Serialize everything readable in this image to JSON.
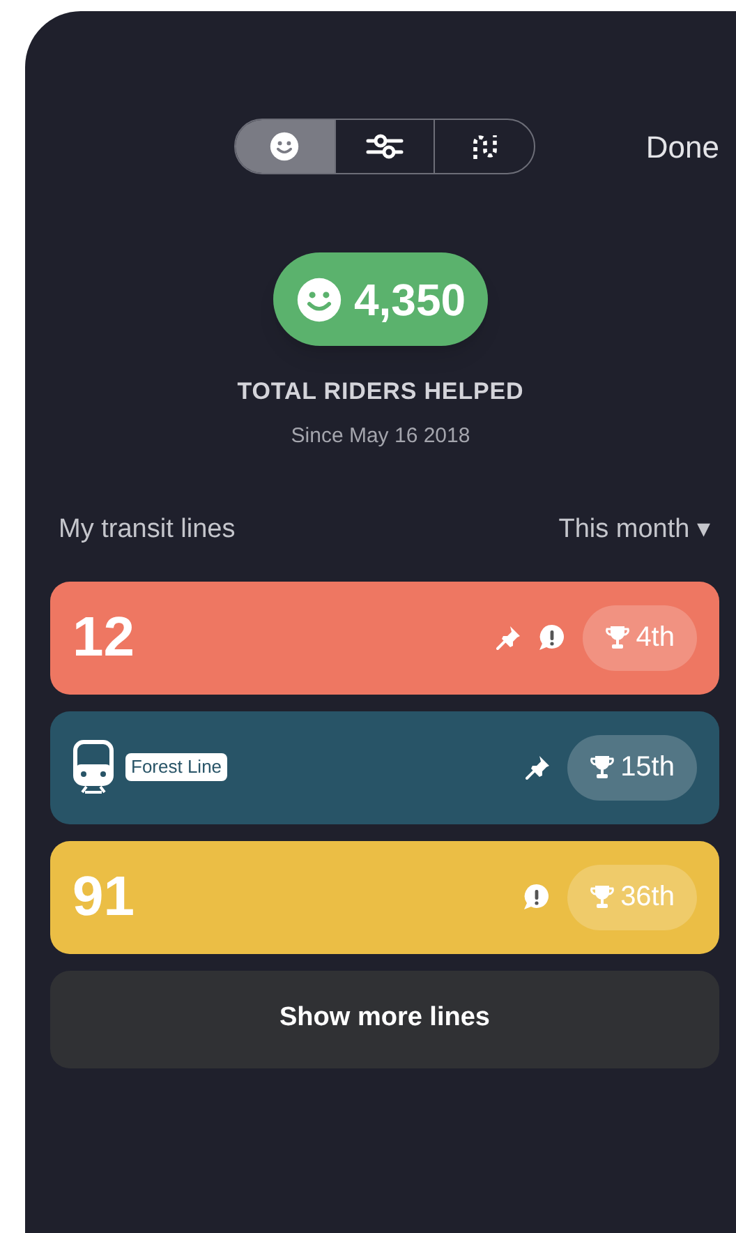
{
  "tabs": [
    {
      "kind": "smile",
      "selected": true
    },
    {
      "kind": "sliders",
      "selected": false
    },
    {
      "kind": "route",
      "selected": false
    }
  ],
  "done": "Done",
  "total": {
    "count": "4,350",
    "label": "TOTAL RIDERS HELPED",
    "since": "Since May 16 2018"
  },
  "section": {
    "title": "My transit lines",
    "period": "This month",
    "period_caret": "▾"
  },
  "lines": [
    {
      "kind": "number",
      "name": "12",
      "color": "#ee7762",
      "pinned": true,
      "alert": true,
      "rank": "4th"
    },
    {
      "kind": "train",
      "name": "Forest Line",
      "color": "#285467",
      "pinned": true,
      "alert": false,
      "rank": "15th"
    },
    {
      "kind": "number",
      "name": "91",
      "color": "#ebbe45",
      "pinned": false,
      "alert": true,
      "rank": "36th"
    }
  ],
  "show_more": "Show more lines"
}
